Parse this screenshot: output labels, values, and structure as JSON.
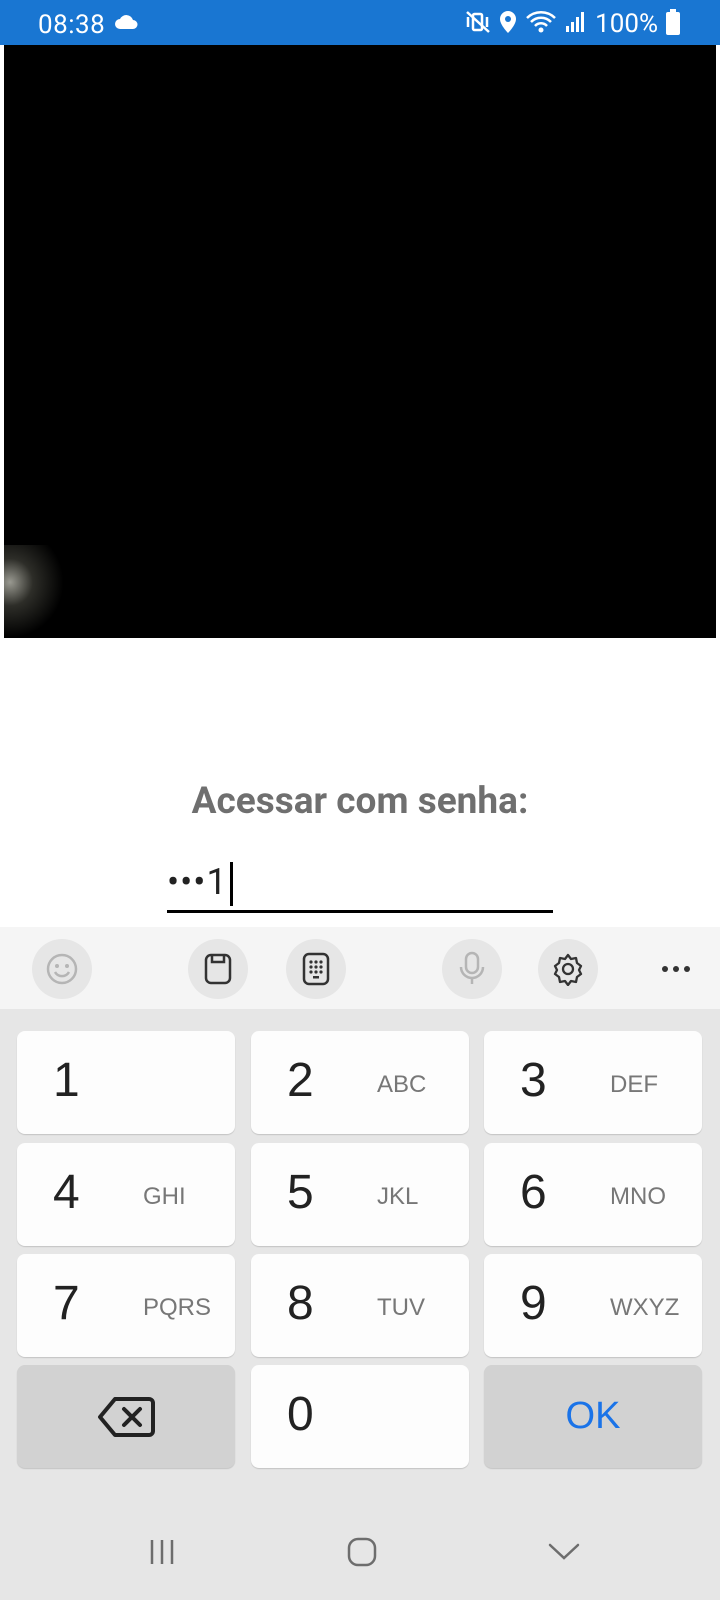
{
  "status_bar": {
    "time": "08:38",
    "battery_text": "100%",
    "background": "#1976d2",
    "icons": [
      "cloud-icon",
      "mute-vibrate-icon",
      "location-icon",
      "wifi-icon",
      "signal-icon",
      "battery-icon"
    ]
  },
  "camera": {
    "background": "#000000"
  },
  "login": {
    "label": "Acessar com senha:",
    "password_value": "•••1"
  },
  "keyboard": {
    "toolbar": [
      "emoji-icon",
      "clipboard-icon",
      "keypad-icon",
      "microphone-icon",
      "settings-icon",
      "more-icon"
    ],
    "keys": [
      {
        "num": "1",
        "letters": ""
      },
      {
        "num": "2",
        "letters": "ABC"
      },
      {
        "num": "3",
        "letters": "DEF"
      },
      {
        "num": "4",
        "letters": "GHI"
      },
      {
        "num": "5",
        "letters": "JKL"
      },
      {
        "num": "6",
        "letters": "MNO"
      },
      {
        "num": "7",
        "letters": "PQRS"
      },
      {
        "num": "8",
        "letters": "TUV"
      },
      {
        "num": "9",
        "letters": "WXYZ"
      },
      {
        "num": "0",
        "letters": ""
      }
    ],
    "ok_label": "OK",
    "accent": "#1a73e8"
  },
  "nav_bar": [
    "recents-icon",
    "home-icon",
    "back-icon"
  ]
}
